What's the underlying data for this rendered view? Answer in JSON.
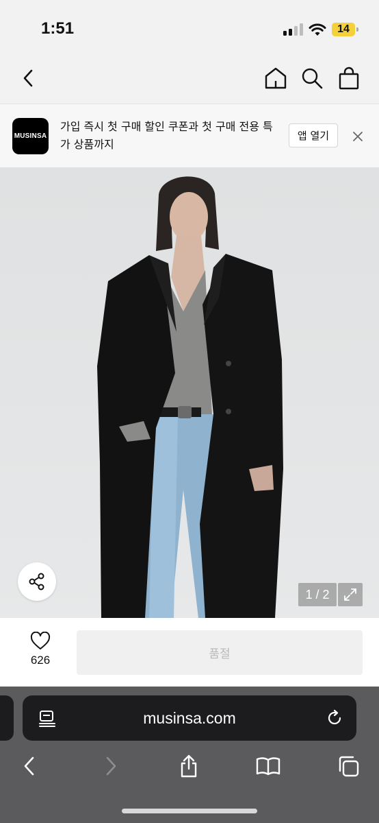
{
  "status_bar": {
    "time": "1:51",
    "battery": "14"
  },
  "nav": {
    "back_icon": "chevron-left-icon",
    "home_icon": "home-icon",
    "search_icon": "search-icon",
    "cart_icon": "shopping-bag-icon"
  },
  "banner": {
    "logo_text": "MUSINSA",
    "message": "가입 즉시 첫 구매 할인 쿠폰과 첫 구매 전용 특가 상품까지",
    "open_app_label": "앱 열기",
    "close_icon": "close-icon"
  },
  "product": {
    "image_counter": "1 / 2",
    "share_icon": "share-icon",
    "fullscreen_icon": "expand-icon"
  },
  "purchase": {
    "like_count": "626",
    "soldout_label": "품절"
  },
  "browser": {
    "url": "musinsa.com"
  },
  "colors": {
    "accent": "#000000",
    "battery": "#f4d03a",
    "soldout_bg": "#f0f0f0"
  }
}
